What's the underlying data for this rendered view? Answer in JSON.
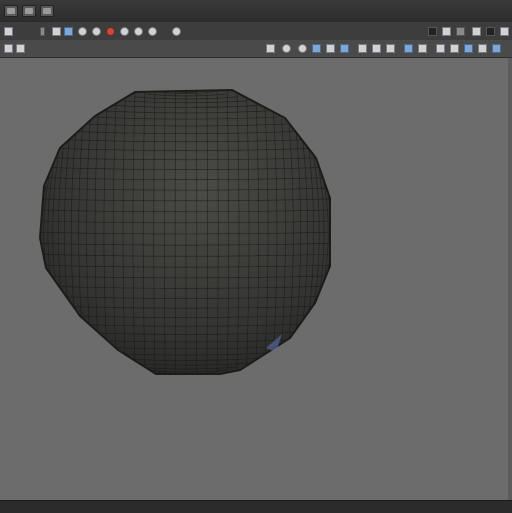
{
  "app": {
    "accent_color": "#7fa7d6",
    "viewport_background": "#6c6c6c",
    "mesh_color": "#3a3a38"
  },
  "titlebar": {
    "buttons": [
      "window-icon",
      "edit-icon",
      "layout-icon"
    ]
  },
  "toolbar_top": {
    "icons": [
      "file-icon",
      "arrow-icon",
      "grid-icon",
      "image-icon",
      "render-icon",
      "camera-icon",
      "material-icon",
      "light-icon",
      "undo-icon",
      "redo-icon",
      "sphere-icon"
    ],
    "right_icons": [
      "panel-icon",
      "record-icon",
      "view-icon",
      "layers-icon",
      "settings-icon"
    ]
  },
  "viewport": {
    "object": "sphere-mesh"
  }
}
